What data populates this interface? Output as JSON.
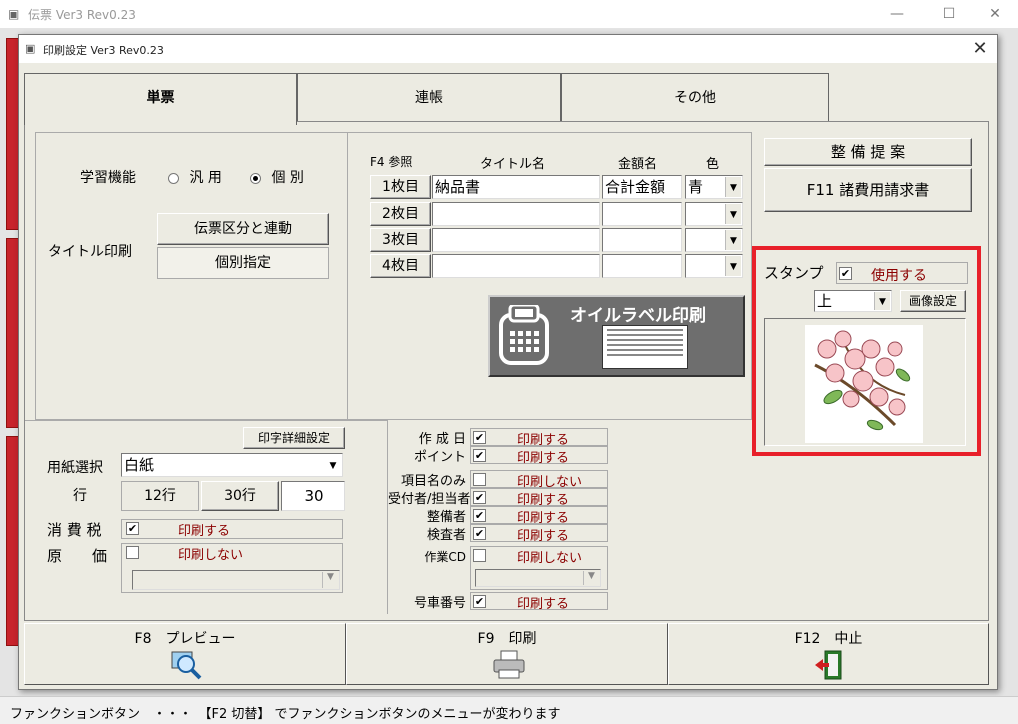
{
  "outer_window": {
    "title": "伝票 Ver3 Rev0.23",
    "status": "ファンクションボタン　・・・　【F2 切替】 でファンクションボタンのメニューが変わります"
  },
  "dialog": {
    "title": "印刷設定 Ver3 Rev0.23"
  },
  "tabs": [
    {
      "label": "単票"
    },
    {
      "label": "連帳"
    },
    {
      "label": "その他"
    }
  ],
  "learning": {
    "label": "学習機能",
    "option1": "汎 用",
    "option2": "個 別",
    "selected": "option2"
  },
  "title_print": {
    "label": "タイトル印刷",
    "btn_link": "伝票区分と連動",
    "btn_individual": "個別指定"
  },
  "sheets": {
    "header_ref": "F4 参照",
    "header_title": "タイトル名",
    "header_amount": "金額名",
    "header_color": "色",
    "rows": [
      {
        "btn": "1枚目",
        "title": "納品書",
        "amount": "合計金額",
        "color": "青"
      },
      {
        "btn": "2枚目",
        "title": "",
        "amount": "",
        "color": ""
      },
      {
        "btn": "3枚目",
        "title": "",
        "amount": "",
        "color": ""
      },
      {
        "btn": "4枚目",
        "title": "",
        "amount": "",
        "color": ""
      }
    ]
  },
  "oil_label": {
    "text": "オイルラベル印刷"
  },
  "right_buttons": {
    "proposal": "整 備 提 案",
    "f11": "F11  諸費用請求書"
  },
  "stamp": {
    "label": "スタンプ",
    "use_label": "使用する",
    "use_checked": true,
    "position": "上",
    "image_btn": "画像設定",
    "highlight_color": "#e8202a"
  },
  "paper": {
    "detail_btn": "印字詳細設定",
    "label": "用紙選択",
    "value": "白紙",
    "rows_label": "行",
    "btn_12": "12行",
    "btn_30": "30行",
    "rows_value": "30"
  },
  "tax": {
    "label": "消 費 税",
    "checked": true,
    "text": "印刷する"
  },
  "cost": {
    "label": "原　　価",
    "checked": false,
    "text": "印刷しない"
  },
  "print_items": [
    {
      "label": "作 成 日",
      "checked": true,
      "text": "印刷する"
    },
    {
      "label": "ポイント",
      "checked": true,
      "text": "印刷する"
    },
    {
      "label": "項目名のみ",
      "checked": false,
      "text": "印刷しない"
    },
    {
      "label": "受付者/担当者",
      "checked": true,
      "text": "印刷する"
    },
    {
      "label": "整備者",
      "checked": true,
      "text": "印刷する"
    },
    {
      "label": "検査者",
      "checked": true,
      "text": "印刷する"
    },
    {
      "label": "作業CD",
      "checked": false,
      "text": "印刷しない"
    },
    {
      "label": "号車番号",
      "checked": true,
      "text": "印刷する"
    }
  ],
  "fkeys": {
    "f8": "F8　プレビュー",
    "f9": "F9　印刷",
    "f12": "F12　中止"
  }
}
